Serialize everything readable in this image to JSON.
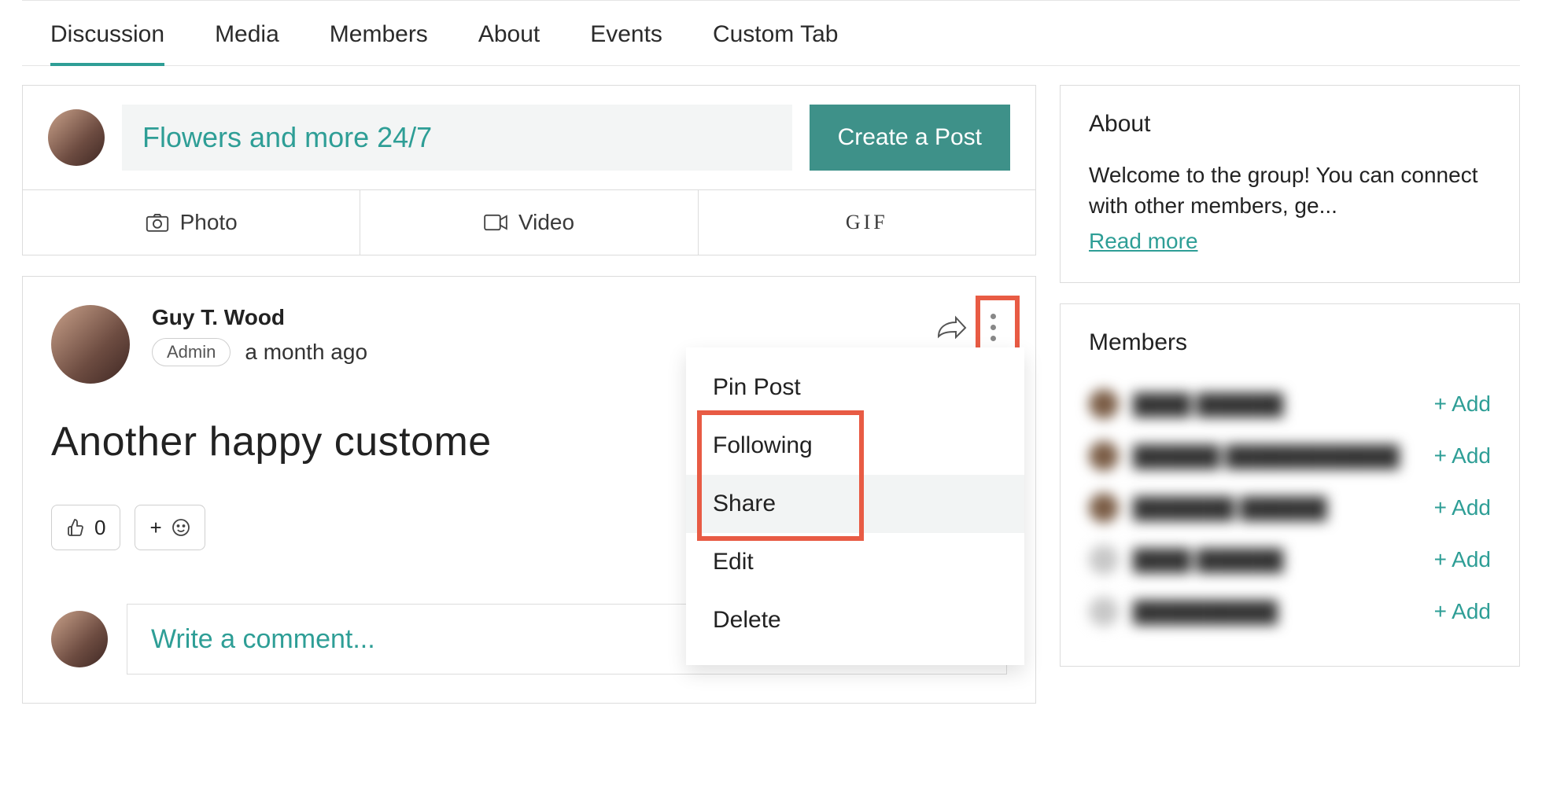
{
  "tabs": [
    "Discussion",
    "Media",
    "Members",
    "About",
    "Events",
    "Custom Tab"
  ],
  "activeTab": 0,
  "composer": {
    "groupName": "Flowers and more 24/7",
    "createLabel": "Create a Post",
    "attachments": {
      "photo": "Photo",
      "video": "Video",
      "gif": "GIF"
    }
  },
  "post": {
    "author": "Guy T. Wood",
    "badge": "Admin",
    "time": "a month ago",
    "content": "Another happy custome",
    "likeCount": "0",
    "menu": [
      "Pin Post",
      "Following",
      "Share",
      "Edit",
      "Delete"
    ]
  },
  "comment": {
    "placeholder": "Write a comment..."
  },
  "about": {
    "title": "About",
    "text": "Welcome to the group! You can connect with other members, ge...",
    "readMore": "Read more"
  },
  "members": {
    "title": "Members",
    "addLabel": "+ Add",
    "list": [
      {
        "avatarTone": "dark"
      },
      {
        "avatarTone": "dark"
      },
      {
        "avatarTone": "dark"
      },
      {
        "avatarTone": "light"
      },
      {
        "avatarTone": "light"
      }
    ]
  }
}
